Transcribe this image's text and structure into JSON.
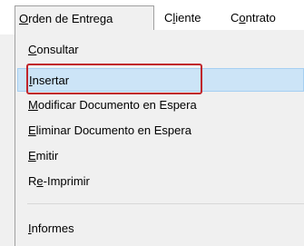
{
  "menubar": {
    "orden_prefix": "O",
    "orden_rest": "rden de Entrega",
    "cliente_prefix": "C",
    "cliente_u": "l",
    "cliente_rest": "iente",
    "contrato_prefix": "C",
    "contrato_u": "o",
    "contrato_rest": "ntrato"
  },
  "menu": {
    "items": [
      {
        "u": "C",
        "rest": "onsultar"
      },
      {
        "u": "I",
        "rest": "nsertar"
      },
      {
        "u": "M",
        "rest": "odificar Documento en Espera"
      },
      {
        "u": "E",
        "rest": "liminar Documento en Espera"
      },
      {
        "u": "E",
        "rest": "mitir"
      },
      {
        "pre": "R",
        "u": "e",
        "rest": "-Imprimir"
      },
      {
        "u": "I",
        "rest": "nformes"
      }
    ]
  },
  "colors": {
    "hover_bg": "#cce4f7",
    "hover_border": "#a6cff2",
    "annotation": "#c0242b"
  }
}
